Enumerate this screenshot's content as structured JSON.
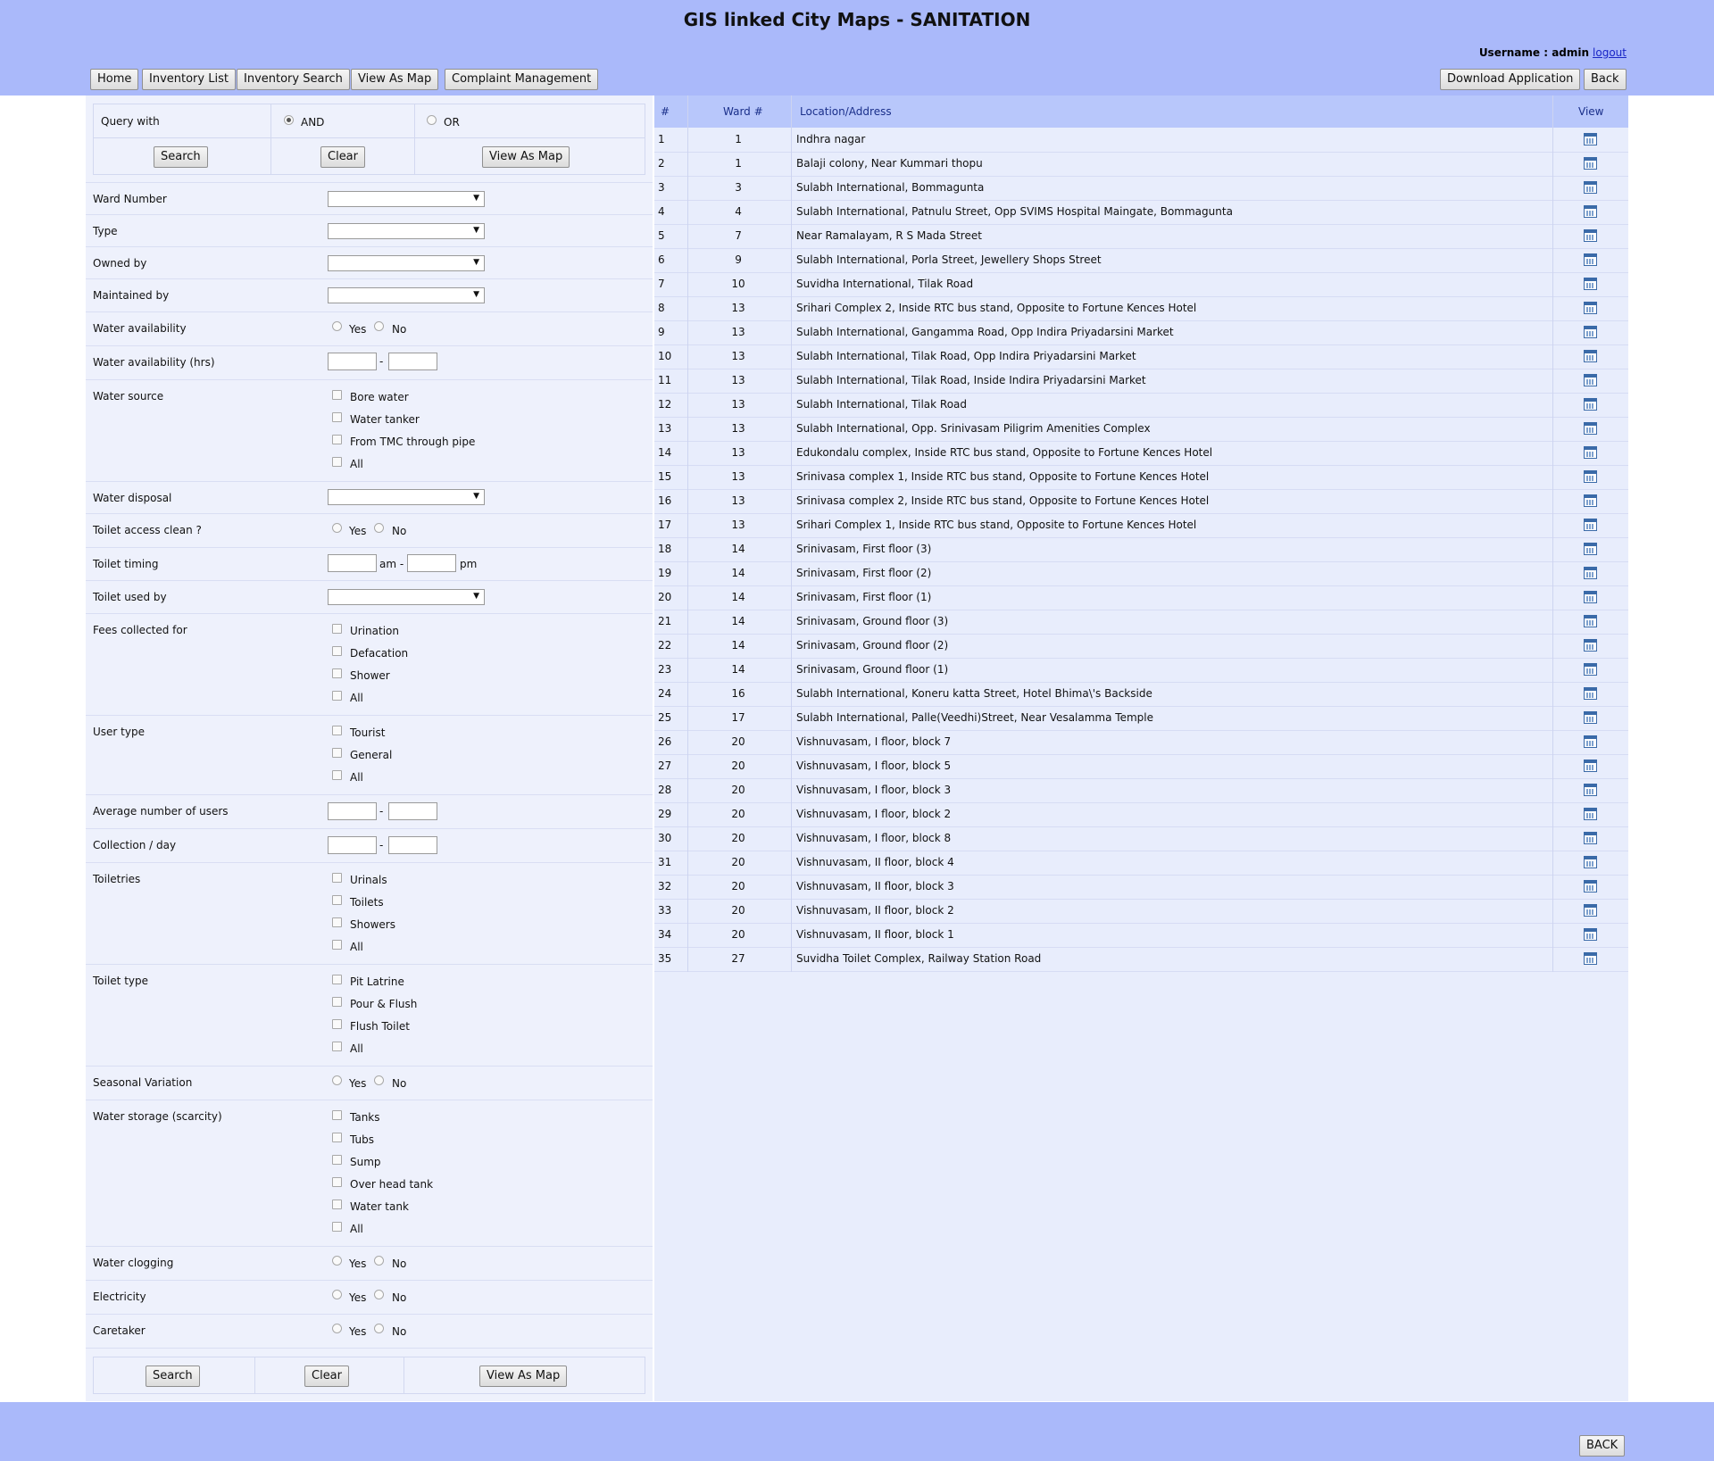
{
  "header": {
    "title": "GIS linked City Maps - SANITATION",
    "username_label": "Username : admin",
    "logout": "logout"
  },
  "nav": {
    "home": "Home",
    "inventory_list": "Inventory List",
    "inventory_search": "Inventory Search",
    "view_as_map": "View As Map",
    "complaint_management": "Complaint Management",
    "download_application": "Download Application",
    "back": "Back"
  },
  "query": {
    "label": "Query with",
    "and": "AND",
    "or": "OR",
    "selected": "AND",
    "search": "Search",
    "clear": "Clear",
    "view_as_map": "View As Map"
  },
  "form": {
    "ward_number": "Ward Number",
    "type": "Type",
    "owned_by": "Owned by",
    "maintained_by": "Maintained by",
    "water_availability": "Water availability",
    "water_availability_hrs": "Water availability (hrs)",
    "water_source": "Water source",
    "water_source_options": [
      "Bore water",
      "Water tanker",
      "From TMC through pipe",
      "All"
    ],
    "water_disposal": "Water disposal",
    "toilet_access_clean": "Toilet access clean ?",
    "toilet_timing": "Toilet timing",
    "am": "am -",
    "pm": "pm",
    "toilet_used_by": "Toilet used by",
    "fees_collected_for": "Fees collected for",
    "fees_options": [
      "Urination",
      "Defacation",
      "Shower",
      "All"
    ],
    "user_type": "User type",
    "user_type_options": [
      "Tourist",
      "General",
      "All"
    ],
    "average_users": "Average number of users",
    "collection_day": "Collection / day",
    "toiletries": "Toiletries",
    "toiletries_options": [
      "Urinals",
      "Toilets",
      "Showers",
      "All"
    ],
    "toilet_type": "Toilet type",
    "toilet_type_options": [
      "Pit Latrine",
      "Pour & Flush",
      "Flush Toilet",
      "All"
    ],
    "seasonal_variation": "Seasonal Variation",
    "water_storage": "Water storage (scarcity)",
    "water_storage_options": [
      "Tanks",
      "Tubs",
      "Sump",
      "Over head tank",
      "Water tank",
      "All"
    ],
    "water_clogging": "Water clogging",
    "electricity": "Electricity",
    "caretaker": "Caretaker",
    "yes": "Yes",
    "no": "No",
    "dash": "-"
  },
  "table": {
    "headers": {
      "num": "#",
      "ward": "Ward #",
      "location": "Location/Address",
      "view": "View"
    },
    "rows": [
      {
        "num": "1",
        "ward": "1",
        "location": "Indhra nagar"
      },
      {
        "num": "2",
        "ward": "1",
        "location": "Balaji colony, Near Kummari thopu"
      },
      {
        "num": "3",
        "ward": "3",
        "location": "Sulabh International, Bommagunta"
      },
      {
        "num": "4",
        "ward": "4",
        "location": "Sulabh International, Patnulu Street, Opp SVIMS Hospital Maingate, Bommagunta"
      },
      {
        "num": "5",
        "ward": "7",
        "location": "Near Ramalayam, R S Mada Street"
      },
      {
        "num": "6",
        "ward": "9",
        "location": "Sulabh International, Porla Street, Jewellery Shops Street"
      },
      {
        "num": "7",
        "ward": "10",
        "location": "Suvidha International, Tilak Road"
      },
      {
        "num": "8",
        "ward": "13",
        "location": "Srihari Complex 2, Inside RTC bus stand, Opposite to Fortune Kences Hotel"
      },
      {
        "num": "9",
        "ward": "13",
        "location": "Sulabh International, Gangamma Road, Opp Indira Priyadarsini Market"
      },
      {
        "num": "10",
        "ward": "13",
        "location": "Sulabh International, Tilak Road, Opp Indira Priyadarsini Market"
      },
      {
        "num": "11",
        "ward": "13",
        "location": "Sulabh International, Tilak Road, Inside Indira Priyadarsini Market"
      },
      {
        "num": "12",
        "ward": "13",
        "location": "Sulabh International, Tilak Road"
      },
      {
        "num": "13",
        "ward": "13",
        "location": "Sulabh International, Opp. Srinivasam Piligrim Amenities Complex"
      },
      {
        "num": "14",
        "ward": "13",
        "location": "Edukondalu complex, Inside RTC bus stand, Opposite to Fortune Kences Hotel"
      },
      {
        "num": "15",
        "ward": "13",
        "location": "Srinivasa complex 1, Inside RTC bus stand, Opposite to Fortune Kences Hotel"
      },
      {
        "num": "16",
        "ward": "13",
        "location": "Srinivasa complex 2, Inside RTC bus stand, Opposite to Fortune Kences Hotel"
      },
      {
        "num": "17",
        "ward": "13",
        "location": "Srihari Complex 1, Inside RTC bus stand, Opposite to Fortune Kences Hotel"
      },
      {
        "num": "18",
        "ward": "14",
        "location": "Srinivasam, First floor (3)"
      },
      {
        "num": "19",
        "ward": "14",
        "location": "Srinivasam, First floor (2)"
      },
      {
        "num": "20",
        "ward": "14",
        "location": "Srinivasam, First floor (1)"
      },
      {
        "num": "21",
        "ward": "14",
        "location": "Srinivasam, Ground floor (3)"
      },
      {
        "num": "22",
        "ward": "14",
        "location": "Srinivasam, Ground floor (2)"
      },
      {
        "num": "23",
        "ward": "14",
        "location": "Srinivasam, Ground floor (1)"
      },
      {
        "num": "24",
        "ward": "16",
        "location": "Sulabh International, Koneru katta Street, Hotel Bhima\\'s Backside"
      },
      {
        "num": "25",
        "ward": "17",
        "location": "Sulabh International, Palle(Veedhi)Street, Near Vesalamma Temple"
      },
      {
        "num": "26",
        "ward": "20",
        "location": "Vishnuvasam, I floor, block 7"
      },
      {
        "num": "27",
        "ward": "20",
        "location": "Vishnuvasam, I floor, block 5"
      },
      {
        "num": "28",
        "ward": "20",
        "location": "Vishnuvasam, I floor, block 3"
      },
      {
        "num": "29",
        "ward": "20",
        "location": "Vishnuvasam, I floor, block 2"
      },
      {
        "num": "30",
        "ward": "20",
        "location": "Vishnuvasam, I floor, block 8"
      },
      {
        "num": "31",
        "ward": "20",
        "location": "Vishnuvasam, II floor, block 4"
      },
      {
        "num": "32",
        "ward": "20",
        "location": "Vishnuvasam, II floor, block 3"
      },
      {
        "num": "33",
        "ward": "20",
        "location": "Vishnuvasam, II floor, block 2"
      },
      {
        "num": "34",
        "ward": "20",
        "location": "Vishnuvasam, II floor, block 1"
      },
      {
        "num": "35",
        "ward": "27",
        "location": "Suvidha Toilet Complex, Railway Station Road"
      }
    ]
  },
  "footer": {
    "back": "BACK"
  },
  "colors": {
    "header_bg": "#aab9fa",
    "panel_bg": "#eef1fc",
    "table_header_bg": "#b8c7fb",
    "link": "#1a26c6"
  }
}
